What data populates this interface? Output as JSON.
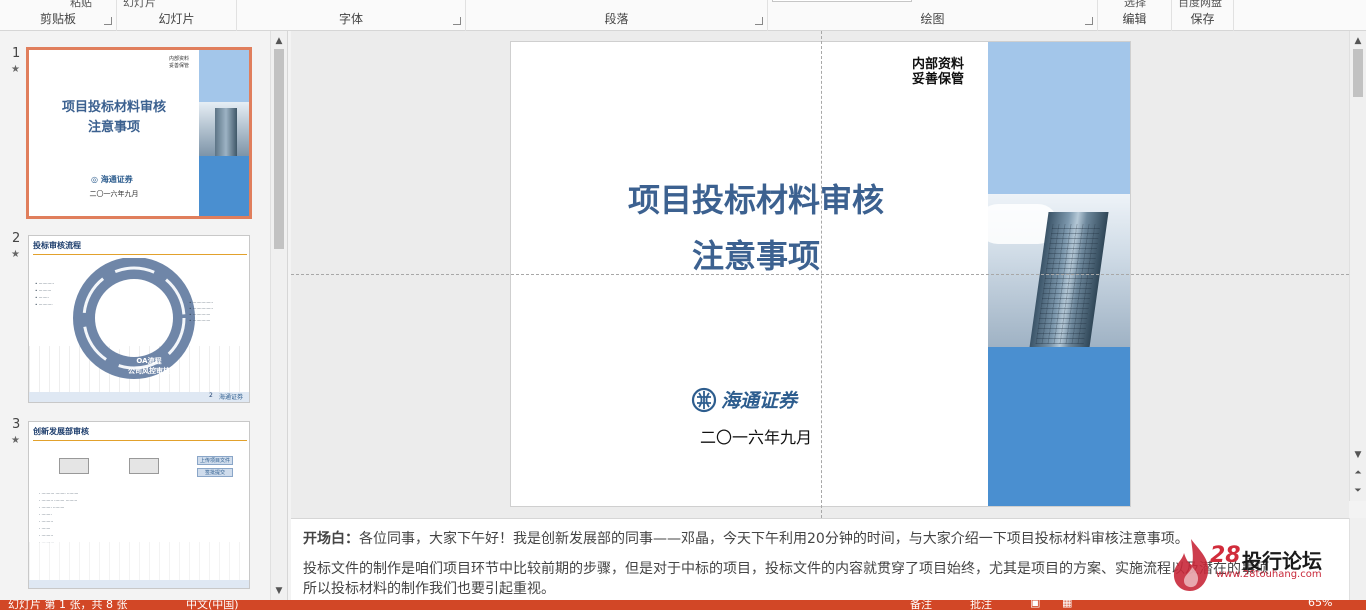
{
  "ribbon": {
    "groups": [
      {
        "label": "剪贴板",
        "cut": "粘贴"
      },
      {
        "label": "幻灯片",
        "cut": "幻灯片"
      },
      {
        "label": "字体",
        "cut": ""
      },
      {
        "label": "段落",
        "cut": ""
      },
      {
        "label": "绘图",
        "cut": ""
      },
      {
        "label": "编辑",
        "cut": "选择"
      },
      {
        "label": "保存",
        "cut": "百度网盘"
      }
    ]
  },
  "thumbnails": [
    {
      "number": "1",
      "star": "★",
      "tag_line1": "内部资料",
      "tag_line2": "妥善保管",
      "title_line1": "项目投标材料审核",
      "title_line2": "注意事项",
      "logo": "海通证券",
      "date": "二〇一六年九月"
    },
    {
      "number": "2",
      "star": "★",
      "title": "投标审核流程",
      "center_line1": "OA流程",
      "center_line2": "公司风控审核",
      "arc_text": "创新发展部审核",
      "page": "2",
      "logo": "海通证券"
    },
    {
      "number": "3",
      "star": "★",
      "title": "创新发展部审核",
      "btn1": "上传项目文件",
      "btn2": "签批提交"
    }
  ],
  "slide": {
    "tag_line1": "内部资料",
    "tag_line2": "妥善保管",
    "title_line1": "项目投标材料审核",
    "title_line2": "注意事项",
    "logo_text": "海通证券",
    "date": "二〇一六年九月"
  },
  "notes": {
    "intro_label": "开场白：",
    "intro_text": "各位同事，大家下午好！我是创新发展部的同事——邓晶，今天下午利用20分钟的时间，与大家介绍一下项目投标材料审核注意事项。",
    "para2": "投标文件的制作是咱们项目环节中比较前期的步骤，但是对于中标的项目，投标文件的内容就贯穿了项目始终，尤其是项目的方案、实施流程以及潜在的事项",
    "para3": "所以投标材料的制作我们也要引起重视。"
  },
  "watermark": {
    "number": "28",
    "text": "投行论坛",
    "url": "www.28touhang.com"
  },
  "status": {
    "slide_info": "幻灯片 第 1 张，共 8 张",
    "language": "中文(中国)",
    "notes_btn": "备注",
    "comments_btn": "批注",
    "zoom": "65%"
  },
  "colors": {
    "accent": "#d24726",
    "title_blue": "#3c6190",
    "panel_light": "#a3c6ea",
    "panel_dark": "#4a8fd0"
  }
}
